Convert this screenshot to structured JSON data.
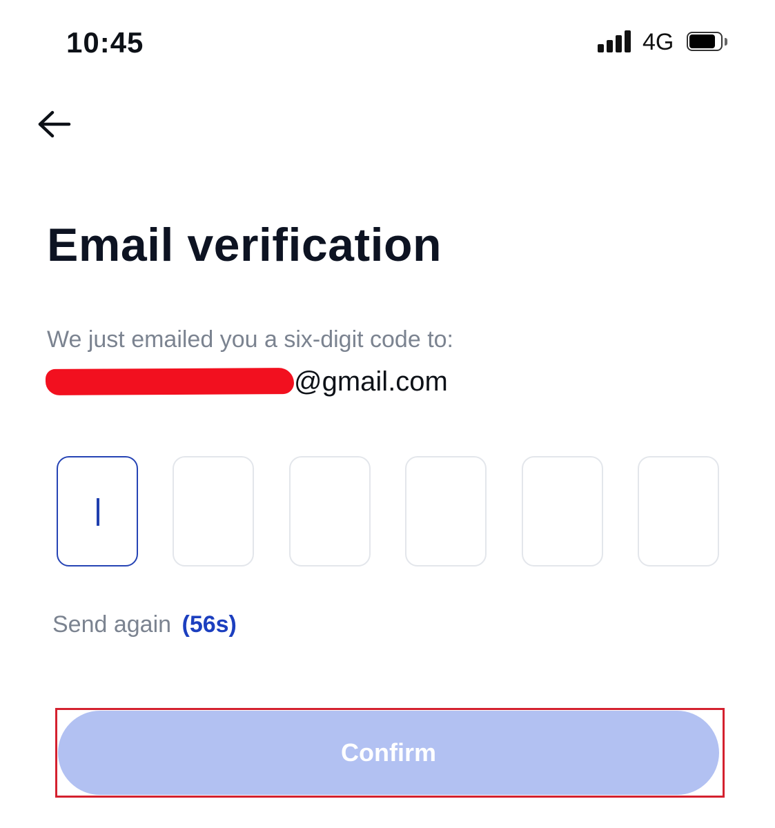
{
  "status_bar": {
    "time": "10:45",
    "network": "4G",
    "signal_bars": 4,
    "battery_level": 0.85
  },
  "header": {
    "back_icon": "arrow-left-icon"
  },
  "title": "Email verification",
  "subtitle": "We just emailed you a six-digit code to:",
  "email": {
    "domain_part": "@gmail.com",
    "redaction_color": "#f2101f"
  },
  "code_input": {
    "length": 6,
    "active_index": 0,
    "values": [
      "",
      "",
      "",
      "",
      "",
      ""
    ]
  },
  "resend": {
    "label": "Send again",
    "countdown": "(56s)"
  },
  "confirm_button": {
    "label": "Confirm",
    "enabled": false
  },
  "colors": {
    "accent": "#1c3fbf",
    "button_disabled": "#b2c1f2",
    "highlight": "#d4212f",
    "muted_text": "#7b8390"
  }
}
